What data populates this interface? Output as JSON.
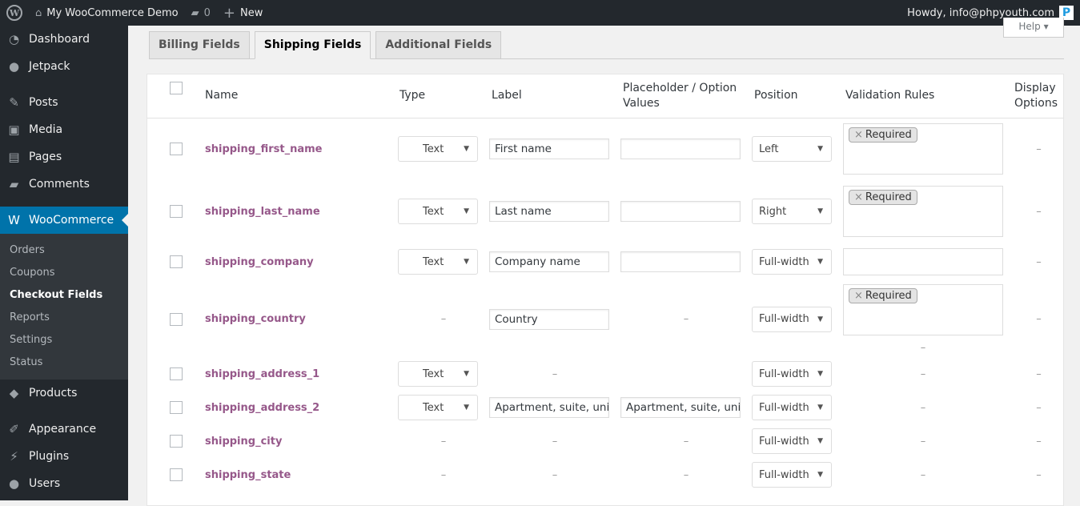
{
  "adminbar": {
    "site": "My WooCommerce Demo",
    "comments": "0",
    "new": "New",
    "howdy": "Howdy, info@phpyouth.com",
    "avatar": "P"
  },
  "sidebar": {
    "items": [
      {
        "label": "Dashboard",
        "icon": "dashboard-icon",
        "glyph": "◔"
      },
      {
        "label": "Jetpack",
        "icon": "jetpack-icon",
        "glyph": "●"
      },
      {
        "sep": true
      },
      {
        "label": "Posts",
        "icon": "pin-icon",
        "glyph": "✎"
      },
      {
        "label": "Media",
        "icon": "media-icon",
        "glyph": "▣"
      },
      {
        "label": "Pages",
        "icon": "pages-icon",
        "glyph": "▤"
      },
      {
        "label": "Comments",
        "icon": "comment-icon",
        "glyph": "▰"
      },
      {
        "sep": true
      },
      {
        "label": "WooCommerce",
        "icon": "woo-icon",
        "glyph": "W",
        "active": true
      }
    ],
    "submenu": [
      "Orders",
      "Coupons",
      "Checkout Fields",
      "Reports",
      "Settings",
      "Status"
    ],
    "submenu_current": "Checkout Fields",
    "items2": [
      {
        "label": "Products",
        "icon": "products-icon",
        "glyph": "◆"
      },
      {
        "sep": true
      },
      {
        "label": "Appearance",
        "icon": "brush-icon",
        "glyph": "✐"
      },
      {
        "label": "Plugins",
        "icon": "plugin-icon",
        "glyph": "⚡"
      },
      {
        "label": "Users",
        "icon": "user-icon",
        "glyph": "●"
      }
    ]
  },
  "help": "Help ▾",
  "tabs": [
    {
      "label": "Billing Fields"
    },
    {
      "label": "Shipping Fields",
      "active": true
    },
    {
      "label": "Additional Fields"
    }
  ],
  "table": {
    "headers": [
      "Name",
      "Type",
      "Label",
      "Placeholder / Option Values",
      "Position",
      "Validation Rules",
      "Display Options"
    ],
    "rows": [
      {
        "name": "shipping_first_name",
        "type": "Text",
        "label": "First name",
        "placeholder": "",
        "position": "Left",
        "validation": [
          "Required"
        ],
        "display": "–"
      },
      {
        "name": "shipping_last_name",
        "type": "Text",
        "label": "Last name",
        "placeholder": "",
        "position": "Right",
        "validation": [
          "Required"
        ],
        "display": "–"
      },
      {
        "name": "shipping_company",
        "type": "Text",
        "label": "Company name",
        "placeholder": "",
        "position": "Full-width",
        "validation": [],
        "display": "–"
      },
      {
        "name": "shipping_country",
        "type": null,
        "label": "Country",
        "placeholder": null,
        "position": "Full-width",
        "validation": [
          "Required"
        ],
        "validation_extra": "–",
        "display": "–"
      },
      {
        "name": "shipping_address_1",
        "type": "Text",
        "label": null,
        "placeholder": null,
        "position": "Full-width",
        "validation": null,
        "display": "–"
      },
      {
        "name": "shipping_address_2",
        "type": "Text",
        "label": "Apartment, suite, unit",
        "placeholder": "Apartment, suite, unit",
        "position": "Full-width",
        "validation": null,
        "display": "–"
      },
      {
        "name": "shipping_city",
        "type": null,
        "label": null,
        "placeholder": null,
        "position": "Full-width",
        "validation": null,
        "display": "–"
      },
      {
        "name": "shipping_state",
        "type": null,
        "label": null,
        "placeholder": null,
        "position": "Full-width",
        "validation": null,
        "display": "–"
      }
    ]
  }
}
